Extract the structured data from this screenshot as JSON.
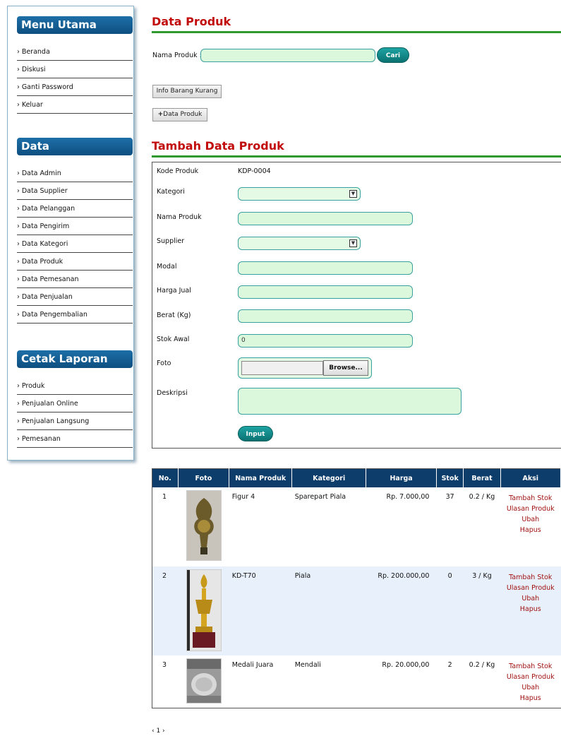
{
  "sidebar": {
    "menu_title": "Menu Utama",
    "menu_items": [
      "Beranda",
      "Diskusi",
      "Ganti Password",
      "Keluar"
    ],
    "data_title": "Data",
    "data_items": [
      "Data Admin",
      "Data Supplier",
      "Data Pelanggan",
      "Data Pengirim",
      "Data Kategori",
      "Data Produk",
      "Data Pemesanan",
      "Data Penjualan",
      "Data Pengembalian"
    ],
    "report_title": "Cetak Laporan",
    "report_items": [
      "Produk",
      "Penjualan Online",
      "Penjualan Langsung",
      "Pemesanan"
    ]
  },
  "header": {
    "title": "Data Produk"
  },
  "search": {
    "label": "Nama Produk :",
    "value": "",
    "button": "Cari"
  },
  "buttons": {
    "info": "Info Barang Kurang",
    "add": "Data Produk"
  },
  "form": {
    "title": "Tambah Data Produk",
    "kode_label": "Kode Produk",
    "kode_value": "KDP-0004",
    "kategori_label": "Kategori",
    "nama_label": "Nama Produk",
    "supplier_label": "Supplier",
    "modal_label": "Modal",
    "harga_label": "Harga Jual",
    "berat_label": "Berat (Kg)",
    "stok_label": "Stok Awal",
    "stok_value": "0",
    "foto_label": "Foto",
    "browse": "Browse...",
    "deskripsi_label": "Deskripsi",
    "submit": "Input"
  },
  "table": {
    "headers": [
      "No.",
      "Foto",
      "Nama Produk",
      "Kategori",
      "Harga",
      "Stok",
      "Berat",
      "Aksi"
    ],
    "rows": [
      {
        "no": "1",
        "nama": "Figur 4",
        "kategori": "Sparepart Piala",
        "harga": "Rp. 7.000,00",
        "stok": "37",
        "berat": "0.2 / Kg"
      },
      {
        "no": "2",
        "nama": "KD-T70",
        "kategori": "Piala",
        "harga": "Rp. 200.000,00",
        "stok": "0",
        "berat": "3 / Kg"
      },
      {
        "no": "3",
        "nama": "Medali Juara",
        "kategori": "Mendali",
        "harga": "Rp. 20.000,00",
        "stok": "2",
        "berat": "0.2 / Kg"
      }
    ],
    "actions": [
      "Tambah Stok",
      "Ulasan Produk",
      "Ubah",
      "Hapus"
    ]
  },
  "pagination": "‹ 1 ›",
  "colors": {
    "title_red": "#c20c0c",
    "accent_green": "#2e9a2e",
    "header_blue": "#0d3d6b",
    "field_green": "#dcf8dc"
  }
}
